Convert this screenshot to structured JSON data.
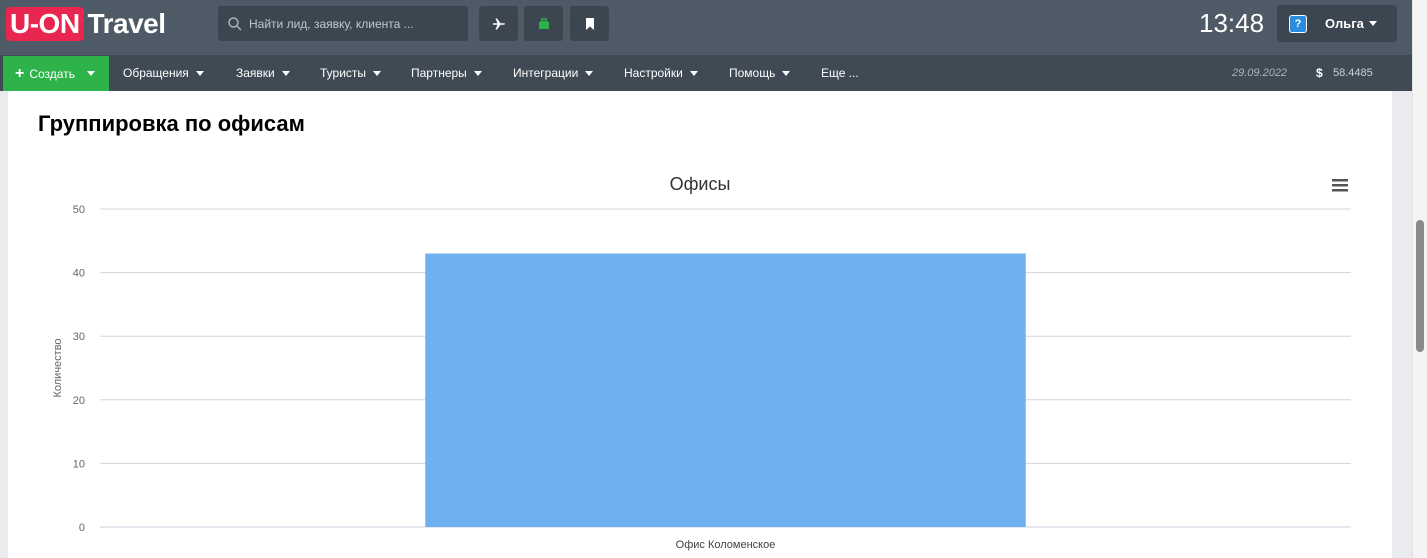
{
  "header": {
    "logo_badge": "U-ON",
    "logo_text": "Travel",
    "search_placeholder": "Найти лид, заявку, клиента ...",
    "time": "13:48",
    "user_name": "Ольга",
    "help_glyph": "?",
    "buttons": [
      {
        "icon": "airplane-icon"
      },
      {
        "icon": "briefcase-icon"
      },
      {
        "icon": "bookmark-icon"
      }
    ]
  },
  "nav": {
    "create_label": "Создать",
    "items": [
      {
        "label": "Обращения"
      },
      {
        "label": "Заявки"
      },
      {
        "label": "Туристы"
      },
      {
        "label": "Партнеры"
      },
      {
        "label": "Интеграции"
      },
      {
        "label": "Настройки"
      },
      {
        "label": "Помощь"
      },
      {
        "label": "Еще ..."
      }
    ],
    "date": "29.09.2022",
    "currency_symbol": "$",
    "rate": "58.4485"
  },
  "page": {
    "title": "Группировка по офисам"
  },
  "chart_data": {
    "type": "bar",
    "title": "Офисы",
    "xlabel": "",
    "ylabel": "Количество",
    "categories": [
      "Офис Коломенское"
    ],
    "values": [
      43
    ],
    "ylim": [
      0,
      50
    ],
    "yticks": [
      0,
      10,
      20,
      30,
      40,
      50
    ],
    "grid": true,
    "bar_color": "#6fb0f0"
  },
  "colors": {
    "topbar": "#4e5b66",
    "navbar": "#3f4a54",
    "create_button": "#2eb24a",
    "logo_badge": "#e8264f"
  }
}
